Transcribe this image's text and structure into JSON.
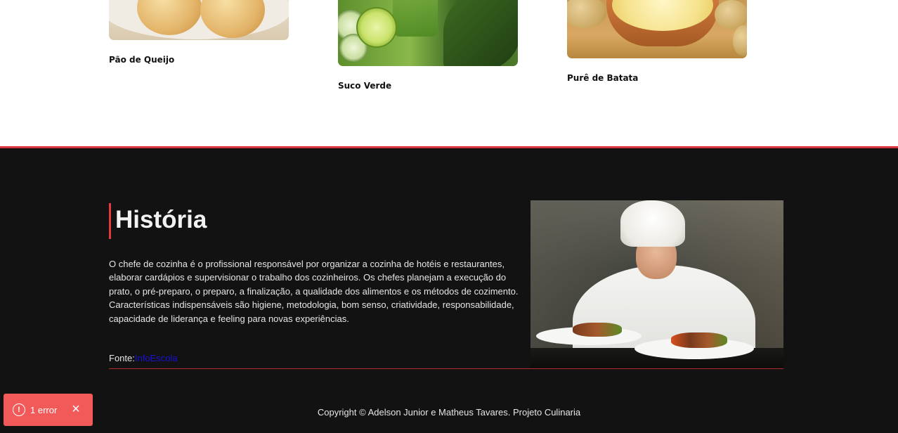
{
  "cards": [
    {
      "title": "Pão de Queijo",
      "image": "pao-de-queijo-photo"
    },
    {
      "title": "Suco Verde",
      "image": "suco-verde-photo"
    },
    {
      "title": "Purê de Batata",
      "image": "pure-de-batata-photo"
    }
  ],
  "history": {
    "title": "História",
    "text": "O chefe de cozinha é o profissional responsável por organizar a cozinha de hotéis e restaurantes, elaborar cardápios e supervisionar o trabalho dos cozinheiros. Os chefes planejam a execução do prato, o pré-preparo, o preparo, a finalização, a qualidade dos alimentos e os métodos de cozimento. Características indispensáveis são higiene, metodologia, bom senso, criatividade, responsabilidade, capacidade de liderança e feeling para novas experiências.",
    "source_label": "Fonte:",
    "source_link": "InfoEscola",
    "image": "chef-plating-photo"
  },
  "footer": {
    "copyright": "Copyright © Adelson Junior e Matheus Tavares. Projeto Culinaria"
  },
  "error_toast": {
    "icon": "!",
    "label": "1 error",
    "close": "×"
  },
  "colors": {
    "accent": "#e53940",
    "dark_bg": "#121212",
    "toast_bg": "#f25a5a",
    "link": "#1a10d6"
  }
}
